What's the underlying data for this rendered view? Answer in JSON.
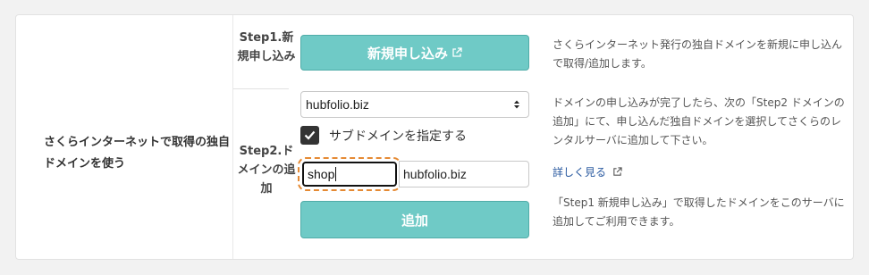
{
  "section": {
    "title": "さくらインターネットで取得の独自ドメインを使う"
  },
  "step1": {
    "label": "Step1.新規申し込み",
    "button_label": "新規申し込み",
    "description": "さくらインターネット発行の独自ドメインを新規に申し込んで取得/追加します。"
  },
  "step2": {
    "label": "Step2.ドメインの追加",
    "domain_select": {
      "selected": "hubfolio.biz"
    },
    "subdomain_checkbox": {
      "checked": true,
      "label": "サブドメインを指定する"
    },
    "subdomain_input": {
      "value": "shop"
    },
    "domain_suffix": "hubfolio.biz",
    "add_button_label": "追加",
    "description": "ドメインの申し込みが完了したら、次の「Step2 ドメインの追加」にて、申し込んだ独自ドメインを選択してさくらのレンタルサーバに追加して下さい。",
    "details_link": "詳しく見る",
    "note": "「Step1 新規申し込み」で取得したドメインをこのサーバに追加してご利用できます。"
  },
  "colors": {
    "button_teal": "#6fcac6",
    "focus_outline": "#e58a34",
    "link_blue": "#2a5aa0"
  },
  "icons": {
    "external_link": "external-link-icon",
    "select_arrows": "select-arrows-icon",
    "checkmark": "checkmark-icon"
  }
}
